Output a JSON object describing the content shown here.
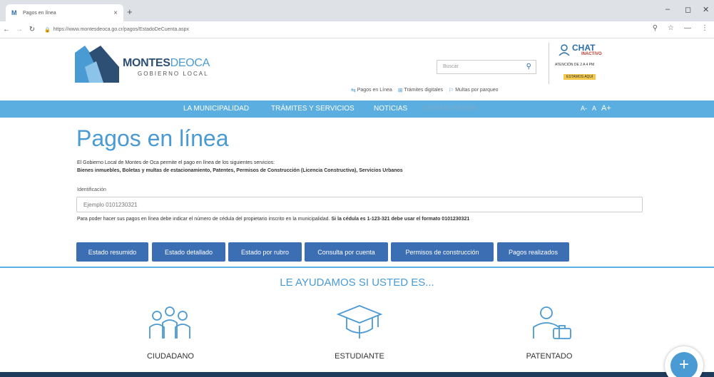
{
  "browser": {
    "tab_title": "Pagos en línea",
    "tab_close": "×",
    "new_tab": "+",
    "url": "https://www.montesdeoca.go.cr/pagos/EstadoDeCuenta.aspx",
    "win_min": "–",
    "win_restore": "◻",
    "win_close": "✕"
  },
  "header": {
    "logo_main_bold": "MONTES",
    "logo_main_light": "DEOCA",
    "logo_sub": "GOBIERNO LOCAL",
    "search_placeholder": "Buscar",
    "chat_title": "CHAT",
    "chat_status": "INACTIVO",
    "chat_hours": "ATENCIÓN DE 2 A 4 PM",
    "chat_badge": "ESTAMOS AQUÍ",
    "quick_links": [
      "Pagos en Línea",
      "Trámites digitales",
      "Multas por parqueo"
    ]
  },
  "nav": {
    "items": [
      "LA MUNICIPALIDAD",
      "TRÁMITES Y SERVICIOS",
      "NOTICIAS",
      "CONTÁCTENOS"
    ],
    "font_small": "A-",
    "font_normal": "A",
    "font_large": "A+"
  },
  "main": {
    "title": "Pagos en línea",
    "intro": "El Gobierno Local de Montes de Oca permite el pago en línea de los siguientes servicios:",
    "services": "Bienes inmuebles, Boletas y multas de estacionamiento, Patentes, Permisos de Construcción (Licencia Constructiva), Servicios Urbanos",
    "id_label": "Identificación",
    "id_placeholder": "Ejemplo 0101230321",
    "hint_normal": "Para poder hacer sus pagos en línea debe indicar el número de cédula del propietario inscrito en la municipalidad. ",
    "hint_bold": "Si la cédula es 1-123-321 debe usar el formato 0101230321",
    "buttons": [
      "Estado resumido",
      "Estado detallado",
      "Estado por rubro",
      "Consulta por cuenta",
      "Permisos de construcción",
      "Pagos realizados"
    ]
  },
  "help": {
    "title": "LE AYUDAMOS SI USTED ES...",
    "audiences": [
      "CIUDADANO",
      "ESTUDIANTE",
      "PATENTADO"
    ]
  },
  "colors": {
    "brand_blue": "#4a9ad4",
    "nav_blue": "#5aaee0",
    "button_blue": "#3c6eb4",
    "dark_navy": "#1f3b5c"
  }
}
